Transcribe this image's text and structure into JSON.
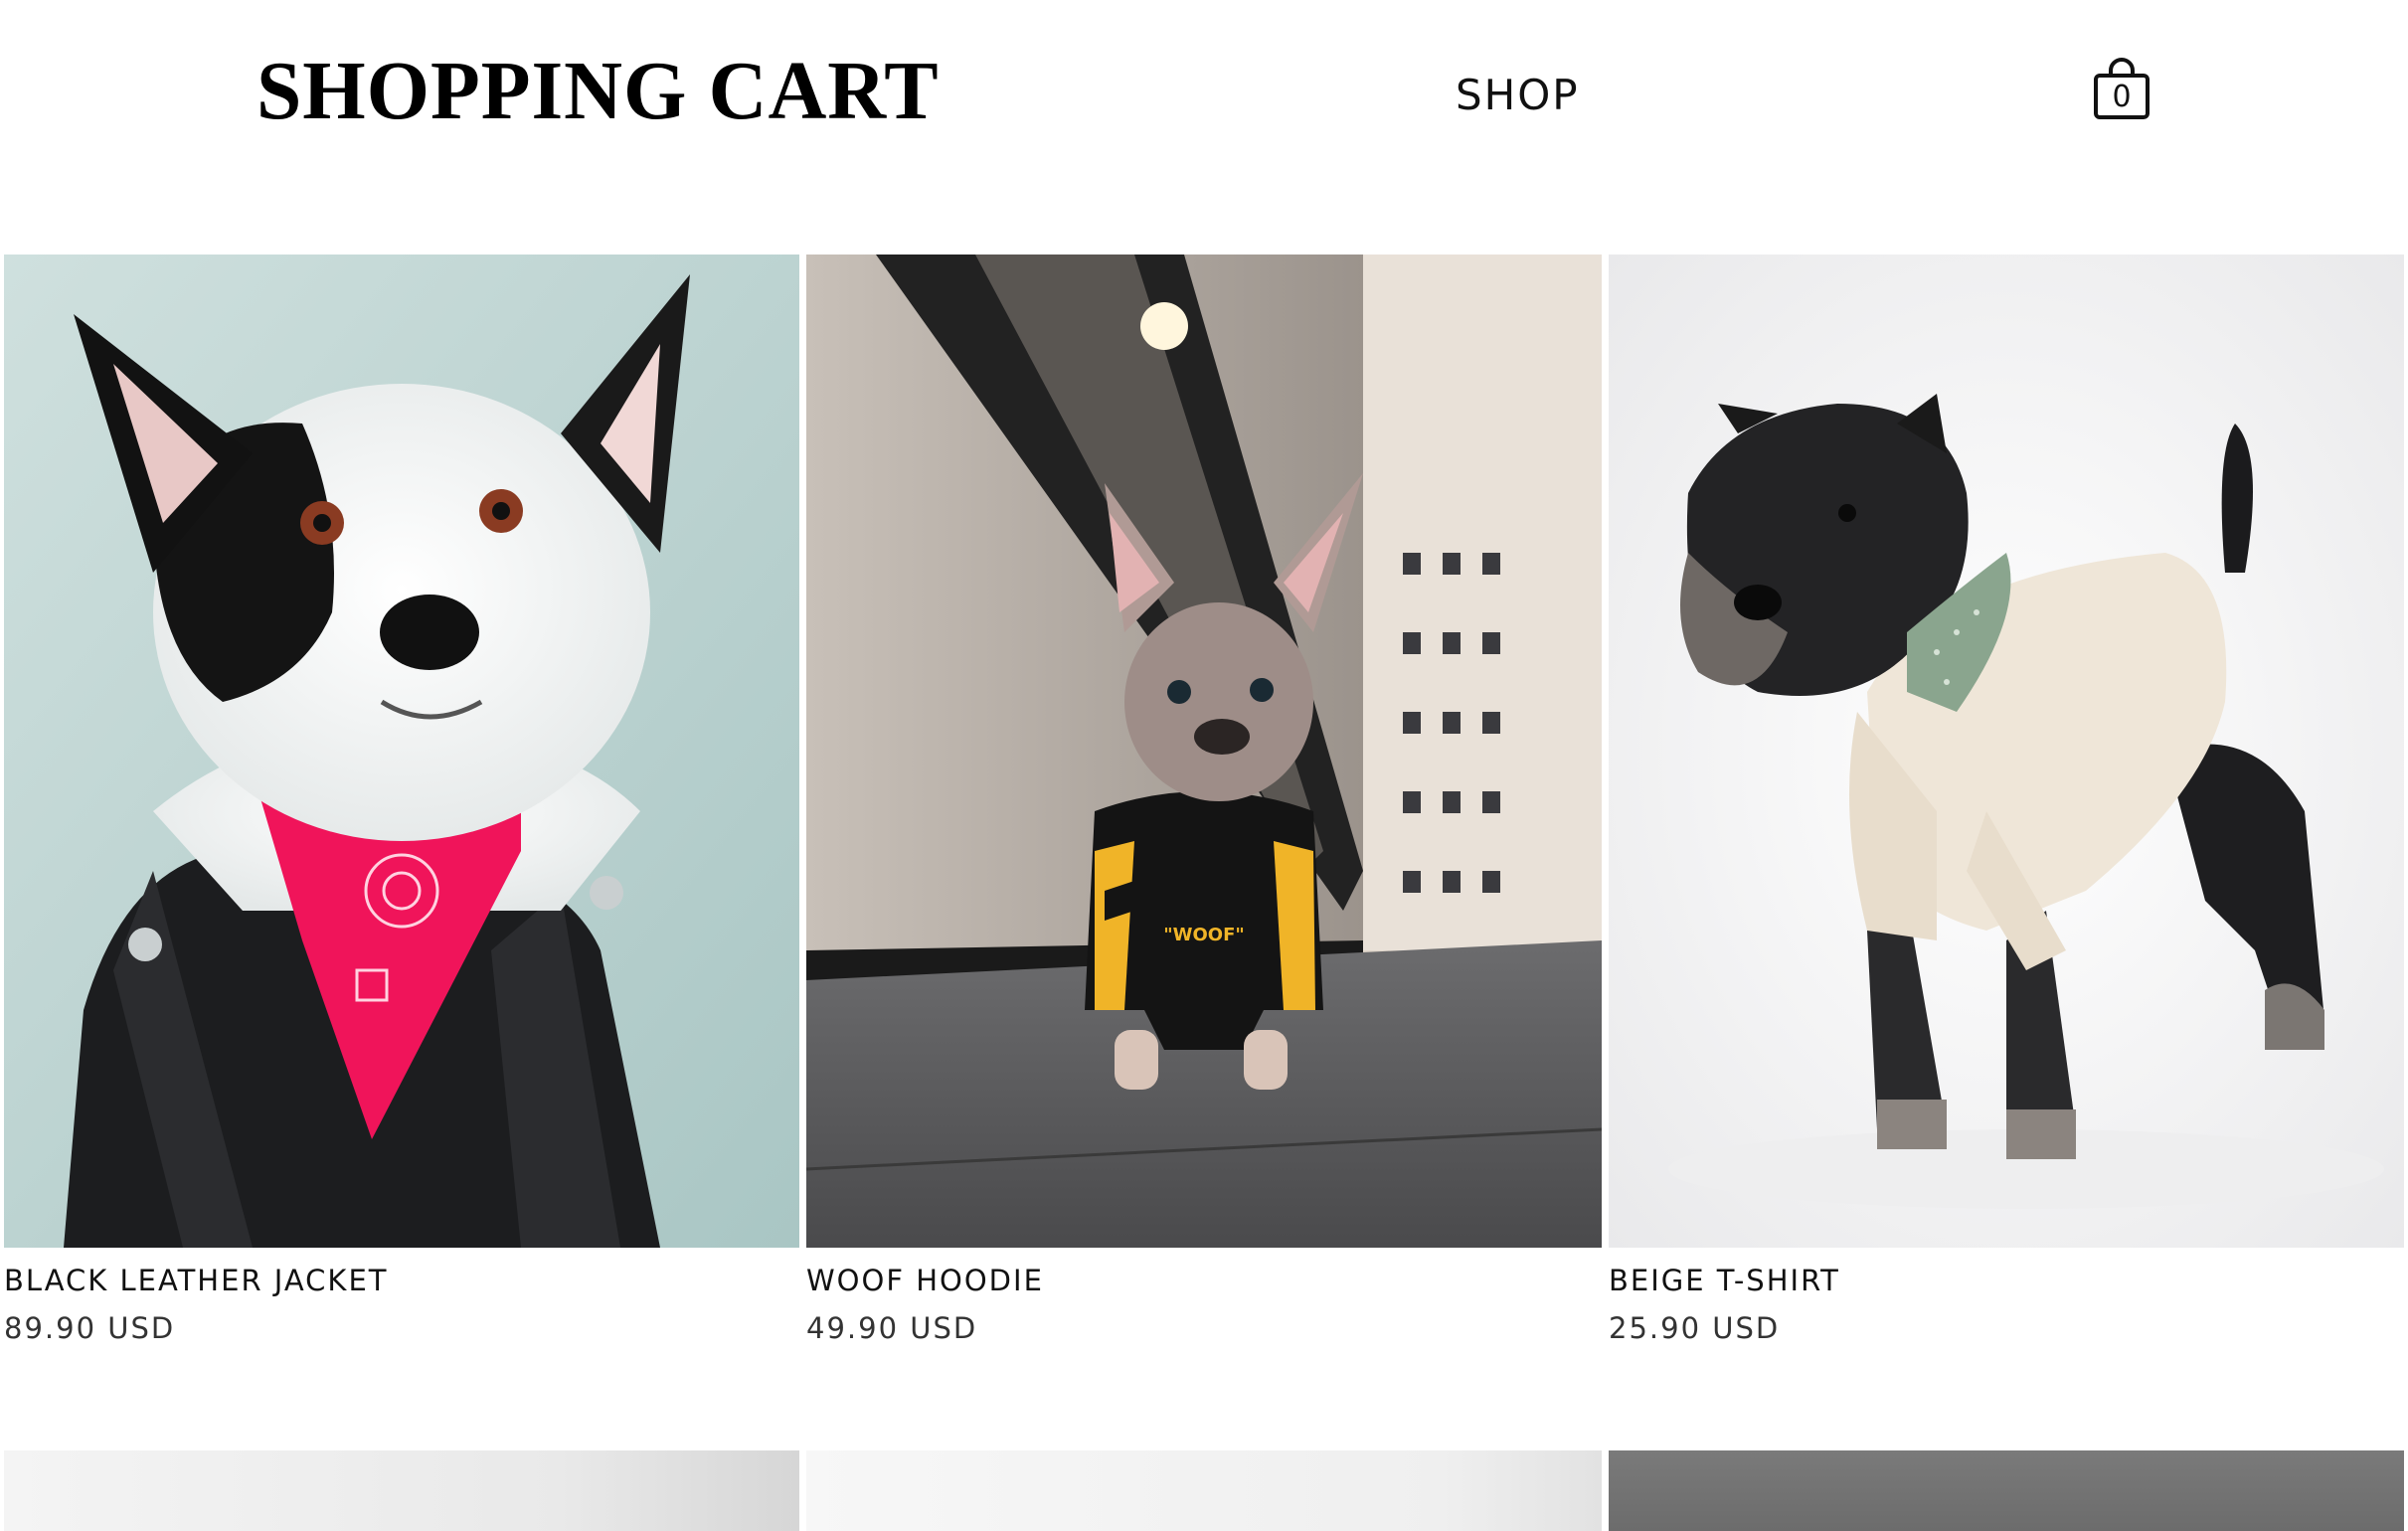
{
  "header": {
    "brand": "SHOPPING CART",
    "nav": {
      "shop_label": "SHOP"
    },
    "cart": {
      "icon": "shopping-bag-icon",
      "count": "0"
    }
  },
  "products": [
    {
      "name": "BLACK LEATHER JACKET",
      "price": "89.90 USD",
      "image": "border collie wearing black leather jacket and pink bandana"
    },
    {
      "name": "WOOF HOODIE",
      "price": "49.90 USD",
      "image": "french bulldog wearing black and yellow striped hoodie on city street",
      "print": "\"WOOF\""
    },
    {
      "name": "BEIGE T-SHIRT",
      "price": "25.90 USD",
      "image": "schnauzer wearing beige t-shirt and green bandana"
    }
  ],
  "colors": {
    "text": "#111111",
    "background": "#ffffff",
    "bandana_pink": "#f0145a",
    "hoodie_yellow": "#f0b428"
  }
}
